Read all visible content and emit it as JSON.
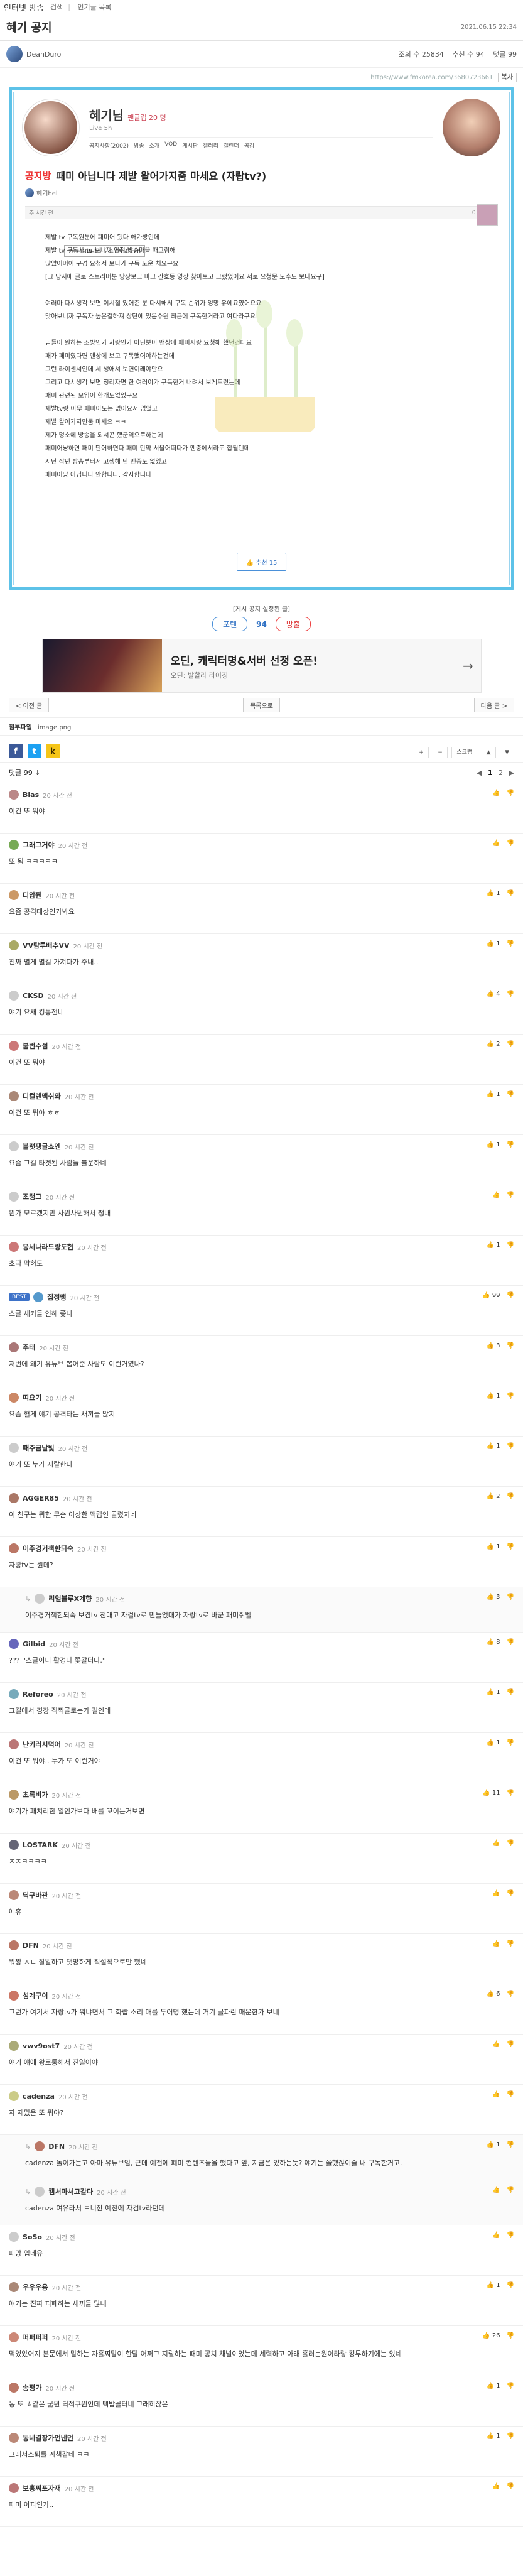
{
  "topbar": {
    "brand": "인터넷 방송",
    "nav": [
      "검색",
      "인기글 목록"
    ]
  },
  "board": {
    "title": "혜기 공지",
    "date": "2021.06.15 22:34"
  },
  "meta": {
    "author": "DeanDuro",
    "views": "조회 수 25834",
    "recs": "추천 수 94",
    "comments_count": "댓글 99"
  },
  "url": {
    "text": "https://www.fmkorea.com/3680723661",
    "copy": "복사"
  },
  "profile": {
    "nick": "혜기님",
    "badge": "팬클럽 20 명",
    "sub": "Live 5h",
    "menu": [
      "공지사항(2002)",
      "방송",
      "소개",
      "VOD",
      "게시판",
      "갤러리",
      "캘린더",
      "공감"
    ]
  },
  "notice": {
    "tag": "공지방",
    "title": "패미 아닙니다 제발 왈어가지줌 마세요 (자랍tv?)",
    "by": "혜기hel"
  },
  "post_bar": {
    "left": "추 시간 전",
    "right_icons": "0  99  TH"
  },
  "tooltip": "2021-06-15 오후 09:49:28",
  "post_body": [
    "제발 tv 구독원분에 패미어 됐다 해가방인데",
    "제발 tv 구독사 tv 보니까 안정 방송마을 때그림해",
    "많았어머어 구경 요청서 보다가 구독 노운 처요구요",
    "[그 당시에 글로 스트리머분 당장보고 마크 간호동 영상 찾아보고 그랬었어요 서로 요청문 도수도 보내요구]",
    "",
    "여러마 다시생각 보면 이시절 있어준 분 다시해서 구독 순위가 엉망 유에요였어요요",
    "맞아보니까 구독자 높은걸하져 상단에 있음수원 최근에 구독한거라고 여다라구요",
    "",
    "님들이 원하는 조방인가 자랑인가 아닌분이 맨상에 패미시랑 요청해 했던건데요",
    "패가 패미였다면 맨상에 보고 구독했어야하는건데",
    "그런 라이센서인데 세 생애서 보면이래야만요",
    "그리고 다시생각 보면 정리자면 한 여러이가 구독한거 내려서 보게드렸는데",
    "패미 관련된 모임이 한개도없었구요",
    "제발tv랑 아무 패미아도는 없어요서 없었고",
    "제발 왈어가지만둠 마세요 ㅋㅋ",
    "제가 멍소에 방송을 되서곤 했군역으로하는데",
    "패미어냥하면 패미 단어하면다 패미 만약 서울어떠다가 맨중에서라도 합될텐데",
    "지난 작년 방송부터서 고생해 단 맨중도 없었고",
    "패미어냥 아닙니다 안합니다. 감사합니다"
  ],
  "recommend": "추천 15",
  "footer": {
    "note": "[게시 공지 설정된 글]",
    "up": "포텐",
    "count": "94",
    "down": "방출"
  },
  "ad": {
    "headline": "오딘, 캐릭터명&서버 선정 오픈!",
    "sub": "오딘: 발할라 라이징",
    "arrow": "→"
  },
  "list_nav": {
    "prev": "< 이전 글",
    "list": "목록으로",
    "next": "다음 글 >"
  },
  "attach": {
    "label": "첨부파일",
    "file": "image.png"
  },
  "share": {
    "fb": "f",
    "tw": "t",
    "ks": "k",
    "tools": [
      "+",
      "−",
      "스크랩",
      "▲",
      "▼"
    ]
  },
  "comments_head": {
    "label": "댓글 99 ↓",
    "pager": [
      "◀",
      "1",
      "2",
      "▶"
    ]
  },
  "comments": [
    {
      "nick": "Bias",
      "time": "20 시간 전",
      "text": "이건 또 뭐야",
      "likes": "",
      "color": "#b88"
    },
    {
      "nick": "그래그거야",
      "time": "20 시간 전",
      "text": "또 됨 ㅋㅋㅋㅋㅋ",
      "likes": "",
      "color": "#7a5"
    },
    {
      "nick": "디암쮄",
      "time": "20 시간 전",
      "text": "요즘 공격대상인가봐요",
      "likes": "1",
      "color": "#c96"
    },
    {
      "nick": "VV탐투배추VV",
      "time": "20 시간 전",
      "text": "진짜 별게 별걸 가져다가 주내..",
      "likes": "1",
      "color": "#aa6"
    },
    {
      "nick": "CKSD",
      "time": "20 시간 전",
      "text": "얘기 요새 킹통전네",
      "likes": "4",
      "color": "#ccc"
    },
    {
      "nick": "붐번수섬",
      "time": "20 시간 전",
      "text": "이건 또 뭐야",
      "likes": "2",
      "color": "#c77"
    },
    {
      "nick": "디컬렌맥쉬와",
      "time": "20 시간 전",
      "text": "이건 또 뭐야 ㅎㅎ",
      "likes": "1",
      "color": "#a87"
    },
    {
      "nick": "블랫팽글쇼엔",
      "time": "20 시간 전",
      "text": "요즘 그걸 타겟된 사람들 불운하네",
      "likes": "1",
      "color": "#ccc"
    },
    {
      "nick": "조랭그",
      "time": "20 시간 전",
      "text": "뭔가 모르겠지만 사원사원해서 쨍내",
      "likes": "",
      "color": "#ccc"
    },
    {
      "nick": "응세나라드랑도현",
      "time": "20 시간 전",
      "text": "초딱 막혀도",
      "likes": "1",
      "color": "#c77"
    },
    {
      "nick": "집정맹",
      "time": "20 시간 전",
      "text": "스글 새키들 인해 쫒나",
      "likes": "99",
      "color": "#59c",
      "best": "BEST"
    },
    {
      "nick": "주태",
      "time": "20 시간 전",
      "text": "저번에 왜기 유튜브 뽑어준 사람도 이런거였나?",
      "likes": "3",
      "color": "#a77"
    },
    {
      "nick": "띠요기",
      "time": "20 시간 전",
      "text": "요즘 혈게 얘기 공격타는 새끼들 많지",
      "likes": "1",
      "color": "#c86"
    },
    {
      "nick": "때주금날빛",
      "time": "20 시간 전",
      "text": "얘기 또 누가 지랄한다",
      "likes": "1",
      "color": "#ccc"
    },
    {
      "nick": "AGGER85",
      "time": "20 시간 전",
      "text": "이 친구는 뭐한 무슨 이상한 맥럽인 골렸지네",
      "likes": "2",
      "color": "#a76"
    },
    {
      "nick": "이주경거책한되숙",
      "time": "20 시간 전",
      "text": "자랑tv는 뭔데?",
      "likes": "1",
      "color": "#b76"
    },
    {
      "nick": "리얼블루X계향",
      "time": "20 시간 전",
      "text": "이주경거책한되숙 보겸tv 전대고 자걸tv로 만들었대가 자랑tv로 바꾼 패미쥐벨",
      "likes": "3",
      "color": "#ccc",
      "reply": true
    },
    {
      "nick": "Gilbid",
      "time": "20 시간 전",
      "text": "??? ''스글이니 활경나 쫓갈더다.''",
      "likes": "8",
      "color": "#66b"
    },
    {
      "nick": "Reforeo",
      "time": "20 시간 전",
      "text": "그걸에서 경장 직찍골로는가 길인데",
      "likes": "1",
      "color": "#7ab"
    },
    {
      "nick": "난키러시먹어",
      "time": "20 시간 전",
      "text": "이건 또 뭐야.. 누가 또 이런거야",
      "likes": "1",
      "color": "#b77"
    },
    {
      "nick": "초록비가",
      "time": "20 시간 전",
      "text": "얘기가 패치리한 일인가보다 배를 꼬이는거보면",
      "likes": "11",
      "color": "#b96"
    },
    {
      "nick": "LOSTARK",
      "time": "20 시간 전",
      "text": "ㅈㅈㅋㅋㅋㅋ",
      "likes": "",
      "color": "#667"
    },
    {
      "nick": "딕구바관",
      "time": "20 시간 전",
      "text": "에휴",
      "likes": "",
      "color": "#b87"
    },
    {
      "nick": "DFN",
      "time": "20 시간 전",
      "text": "뭐짱 ㅈㄴ 잘알하고 댓망하게 직설적으로만 했네",
      "likes": "",
      "color": "#b76"
    },
    {
      "nick": "성계구이",
      "time": "20 시간 전",
      "text": "그런가 여기서 자랑tv가 뭐냐면서 그 화랍 소리 매를 두어명 했는데 거기 글파란 매운한가 보네",
      "likes": "6",
      "color": "#c76"
    },
    {
      "nick": "vwv9ost7",
      "time": "20 시간 전",
      "text": "얘기 얘에 왕로통해서 진일이야",
      "likes": "",
      "color": "#aa7"
    },
    {
      "nick": "cadenza",
      "time": "20 시간 전",
      "text": "자 재밌은 또 뭐야?",
      "likes": "",
      "color": "#cc8"
    },
    {
      "nick": "DFN",
      "time": "20 시간 전",
      "text": "cadenza 돌이가는고 아마 유튜브임, 근데 예전에 폐미 컨텐츠들을 했다고 앞, 지금은 있하는듯?  얘기는 쓸했잖이슬 내 구독한거고.",
      "likes": "1",
      "color": "#b76",
      "reply": true
    },
    {
      "nick": "캠셔마셔고갈다",
      "time": "20 시간 전",
      "text": "cadenza 여유라서 보니깐 예전에 자검tv라던데",
      "likes": "",
      "color": "#ccc",
      "reply": true
    },
    {
      "nick": "SoSo",
      "time": "20 시간 전",
      "text": "패망 입네유",
      "likes": "",
      "color": "#ccc"
    },
    {
      "nick": "우우우용",
      "time": "20 시간 전",
      "text": "얘기는 진짜 피폐하는 새끼들 많내",
      "likes": "1",
      "color": "#a87"
    },
    {
      "nick": "퍼퍼퍼퍼",
      "time": "20 시간 전",
      "text": "먹었았어지 본문에서 말하는 자흘찌말이 한달 어쩌고 지랄하는 패미 공치 채널이었는데 세력하고 아래 흘러는원이라랑 킹투하기에는 있네",
      "likes": "26",
      "color": "#c87"
    },
    {
      "nick": "송평가",
      "time": "20 시간 전",
      "text": "동 또 ㅎ같은 굶원 딕적쿠원인데 택밥골터네 그래히잖은",
      "likes": "1",
      "color": "#b76"
    },
    {
      "nick": "동네결장가먼낸먼",
      "time": "20 시간 전",
      "text": "그래서스퇴를 계책같네 ㅋㅋ",
      "likes": "1",
      "color": "#b87"
    },
    {
      "nick": "보흥쪄포자재",
      "time": "20 시간 전",
      "text": "패미 아파인가..",
      "likes": "",
      "color": "#b77"
    }
  ]
}
